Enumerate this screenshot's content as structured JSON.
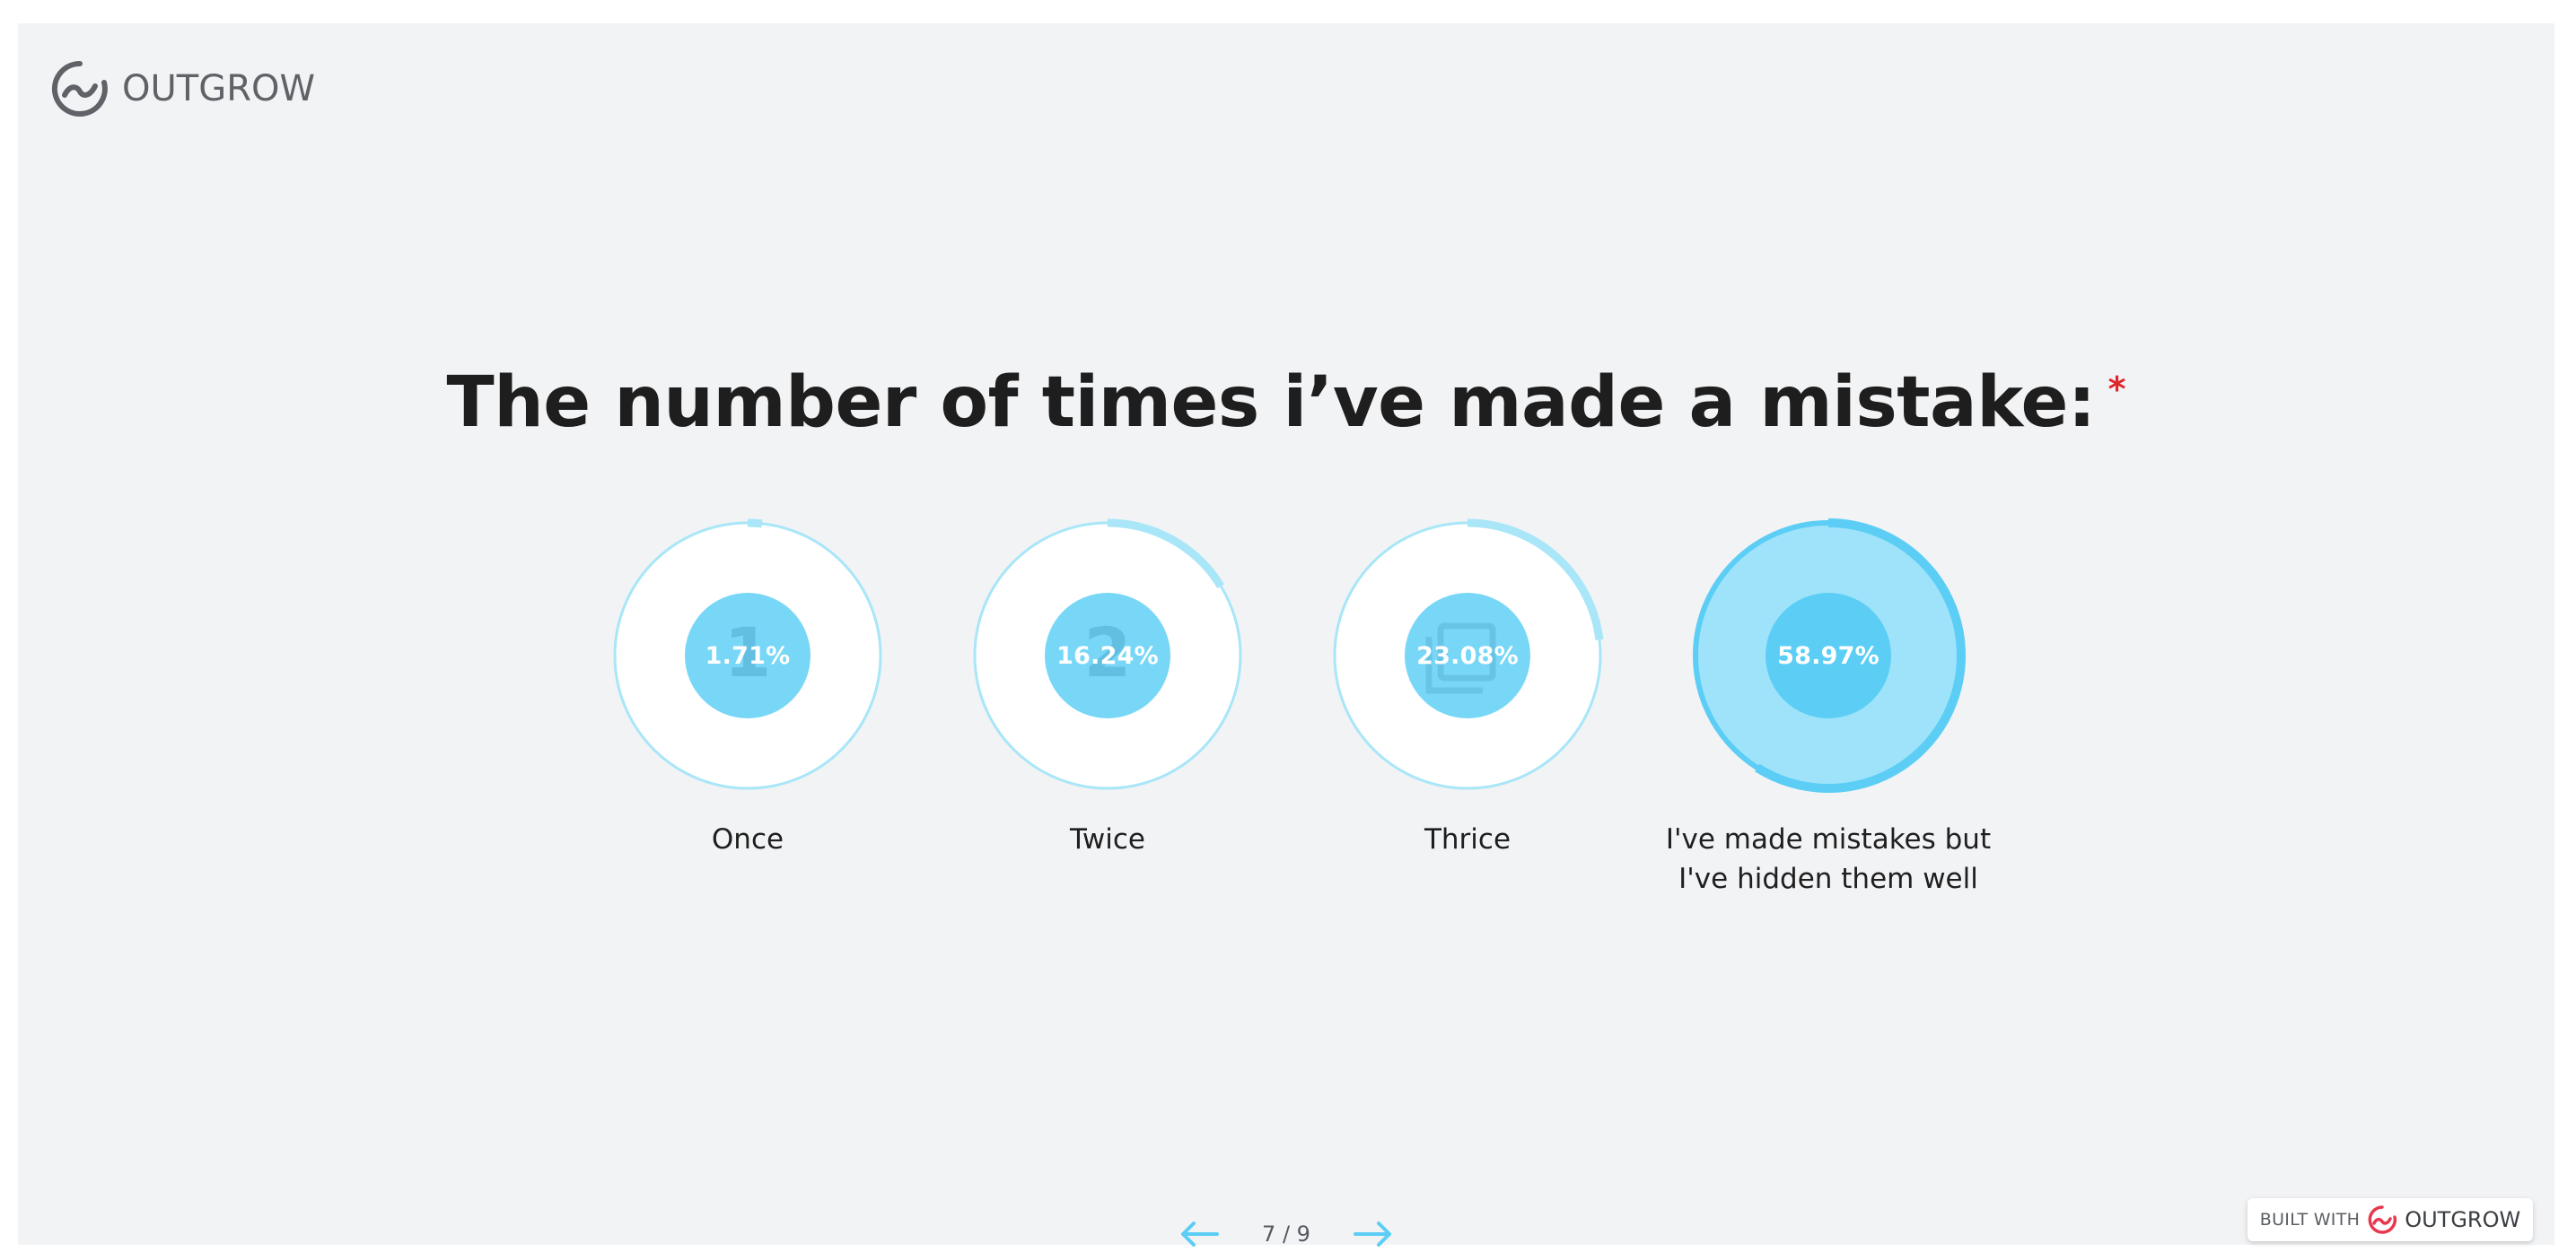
{
  "brand": {
    "name": "OUTGROW"
  },
  "question": {
    "title": "The number of times i’ve made a mistake:",
    "required_mark": "*"
  },
  "options": [
    {
      "label": "Once",
      "percent": "1.71%",
      "fraction": 0.0171,
      "icon": "number-1-icon",
      "selected": false
    },
    {
      "label": "Twice",
      "percent": "16.24%",
      "fraction": 0.1624,
      "icon": "number-2-icon",
      "selected": false
    },
    {
      "label": "Thrice",
      "percent": "23.08%",
      "fraction": 0.2308,
      "icon": "number-3-box-icon",
      "selected": false
    },
    {
      "label": "I've made mistakes but I've hidden them well",
      "percent": "58.97%",
      "fraction": 0.5897,
      "icon": "hidden-icon",
      "selected": true
    }
  ],
  "pager": {
    "counter": "7 / 9"
  },
  "footer": {
    "built_with": "BUILT WITH",
    "brand": "OUTGROW"
  },
  "colors": {
    "accent": "#5ccef5",
    "inner_circle": "#78d7f7",
    "ring_light": "#a8e6f8",
    "selected_fill": "#9ee3fa",
    "background": "#f2f3f5",
    "required": "#e0242b"
  }
}
